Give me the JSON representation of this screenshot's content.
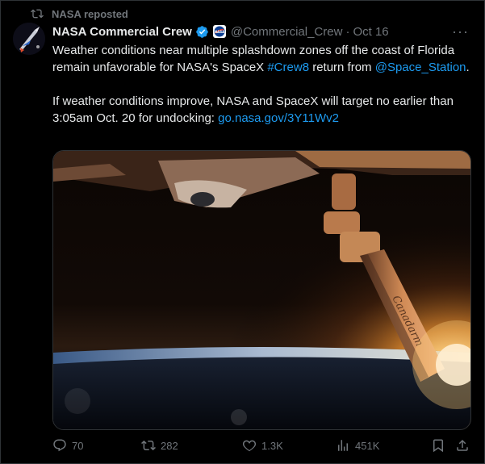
{
  "repost": {
    "icon": "repost-icon",
    "text": "NASA reposted"
  },
  "author": {
    "name": "NASA Commercial Crew",
    "handle": "@Commercial_Crew",
    "separator": "·",
    "date": "Oct 16",
    "avatar_icon": "commercial-crew-logo",
    "verified_icon": "verified-badge-icon",
    "org_icon": "nasa-meatball-icon"
  },
  "tweet": {
    "p1_a": "Weather conditions near multiple splashdown zones off the coast of Florida remain unfavorable for NASA's SpaceX ",
    "p1_hashtag": "#Crew8",
    "p1_b": " return from ",
    "p1_mention": "@Space_Station",
    "p1_c": ".",
    "p2_a": "If weather conditions improve, NASA and SpaceX will target no earlier than 3:05am Oct. 20 for undocking: ",
    "p2_link": "go.nasa.gov/3Y11Wv2"
  },
  "media": {
    "description_icon": "iss-robotic-arm-sunrise-photo",
    "arm_text": "Canadarm"
  },
  "actions": {
    "replies": "70",
    "reposts": "282",
    "likes": "1.3K",
    "views": "451K"
  },
  "colors": {
    "accent": "#1d9bf0",
    "muted": "#71767b",
    "text": "#e7e9ea",
    "verified": "#1d9bf0"
  }
}
